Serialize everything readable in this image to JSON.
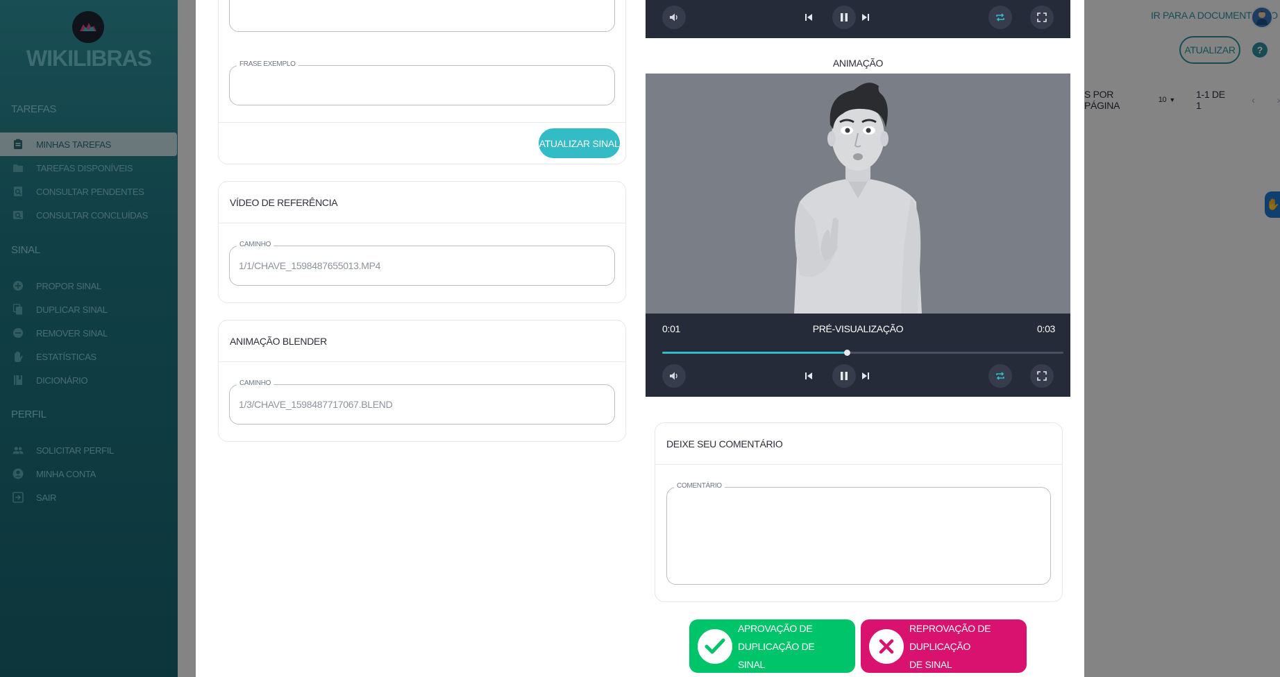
{
  "app": {
    "name": "WIKILIBRAS"
  },
  "sidebar": {
    "sections": [
      {
        "title": "TAREFAS",
        "items": [
          {
            "label": "MINHAS TAREFAS",
            "icon": "clipboard-icon",
            "active": true
          },
          {
            "label": "TAREFAS DISPONÍVEIS",
            "icon": "folder-icon"
          },
          {
            "label": "CONSULTAR PENDENTES",
            "icon": "search-doc-icon"
          },
          {
            "label": "CONSULTAR CONCLUÍDAS",
            "icon": "image-search-icon"
          }
        ]
      },
      {
        "title": "SINAL",
        "items": [
          {
            "label": "PROPOR SINAL",
            "icon": "plus-circle-icon"
          },
          {
            "label": "DUPLICAR SINAL",
            "icon": "copy-icon"
          },
          {
            "label": "REMOVER SINAL",
            "icon": "minus-circle-icon"
          },
          {
            "label": "ESTATÍSTICAS",
            "icon": "hand-icon"
          },
          {
            "label": "DICIONÁRIO",
            "icon": "book-icon"
          }
        ]
      },
      {
        "title": "PERFIL",
        "items": [
          {
            "label": "SOLICITAR PERFIL",
            "icon": "people-icon"
          },
          {
            "label": "MINHA CONTA",
            "icon": "account-icon"
          },
          {
            "label": "SAIR",
            "icon": "exit-icon"
          }
        ]
      }
    ]
  },
  "header": {
    "doc_link": "IR PARA A DOCUMENTAÇÃO",
    "refresh_label": "ATUALIZAR",
    "help": "?",
    "pager": {
      "rows_label": "S POR PÁGINA",
      "rows_value": "10",
      "range": "1-1 DE 1"
    }
  },
  "form": {
    "example_phrase": {
      "label": "FRASE EXEMPLO",
      "value": ""
    },
    "update_sign_button": "ATUALIZAR SINAL",
    "reference_video": {
      "title": "VÍDEO DE REFERÊNCIA",
      "path_label": "CAMINHO",
      "path_value": "1/1/CHAVE_1598487655013.MP4"
    },
    "blender_animation": {
      "title": "ANIMAÇÃO BLENDER",
      "path_label": "CAMINHO",
      "path_value": "1/3/CHAVE_1598487717067.BLEND"
    }
  },
  "animation": {
    "label": "ANIMAÇÃO",
    "current_time": "0:01",
    "title": "PRÉ-VISUALIZAÇÃO",
    "duration": "0:03",
    "progress": 0.46
  },
  "comment": {
    "title": "DEIXE SEU COMENTÁRIO",
    "field_label": "COMENTÁRIO",
    "value": ""
  },
  "actions": {
    "approve_line1": "APROVAÇÃO DE DUPLICAÇÃO DE",
    "approve_line2": "SINAL",
    "reject_line1": "REPROVAÇÃO DE DUPLICAÇÃO",
    "reject_line2": "DE SINAL",
    "approve_color": "#00c46a",
    "reject_color": "#d8126e"
  },
  "colors": {
    "teal": "#33bcc6",
    "player": "#262b3a",
    "sidebar": "#1f7480"
  }
}
